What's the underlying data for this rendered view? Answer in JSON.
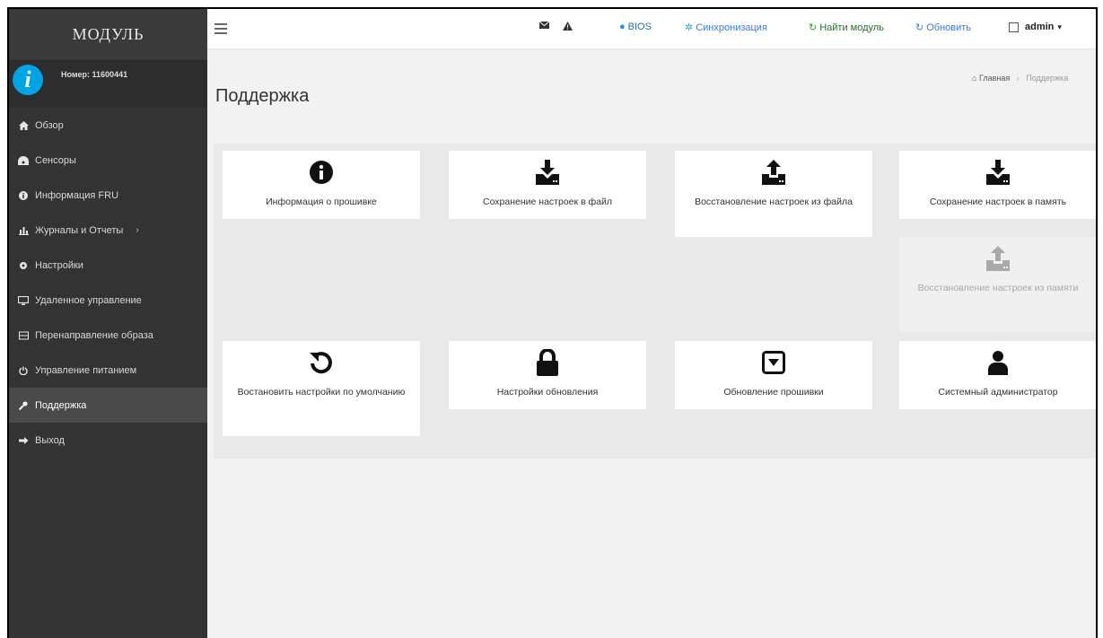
{
  "sidebar": {
    "brand": "МОДУЛЬ",
    "user_number": "Номер: 11600441",
    "items": [
      {
        "label": "Обзор",
        "icon": "home-icon"
      },
      {
        "label": "Сенсоры",
        "icon": "dashboard-icon"
      },
      {
        "label": "Информация FRU",
        "icon": "info-icon"
      },
      {
        "label": "Журналы и Отчеты",
        "icon": "bar-chart-icon",
        "caret": "›"
      },
      {
        "label": "Настройки",
        "icon": "gear-icon"
      },
      {
        "label": "Удаленное управление",
        "icon": "monitor-icon"
      },
      {
        "label": "Перенаправление образа",
        "icon": "disk-icon"
      },
      {
        "label": "Управление питанием",
        "icon": "power-icon"
      },
      {
        "label": "Поддержка",
        "icon": "wrench-icon",
        "active": true
      },
      {
        "label": "Выход",
        "icon": "sign-out-icon"
      }
    ]
  },
  "topbar": {
    "bios": "BIOS",
    "sync": "Синхронизация",
    "find": "Найти модуль",
    "refresh": "Обновить",
    "user": "admin"
  },
  "page": {
    "title": "Поддержка",
    "breadcrumb_home": "Главная",
    "breadcrumb_current": "Поддержка"
  },
  "cards": [
    {
      "label": "Информация о прошивке",
      "icon": "info-circle-icon"
    },
    {
      "label": "Сохранение настроек в файл",
      "icon": "download-icon"
    },
    {
      "label": "Восстановление настроек из файла",
      "icon": "upload-icon"
    },
    {
      "label": "Сохранение настроек в память",
      "icon": "download-icon"
    },
    {
      "label": "Восстановление настроек из памяти",
      "icon": "upload-icon",
      "disabled": true
    },
    {
      "label": "Востановить настройки по умолчанию",
      "icon": "undo-icon"
    },
    {
      "label": "Настройки обновления",
      "icon": "lock-icon"
    },
    {
      "label": "Обновление прошивки",
      "icon": "caret-square-down-icon"
    },
    {
      "label": "Системный администратор",
      "icon": "user-icon"
    }
  ],
  "colors": {
    "sidebar_bg": "#333333",
    "accent": "#00a4e4",
    "panel_bg": "#e9e9e9"
  }
}
